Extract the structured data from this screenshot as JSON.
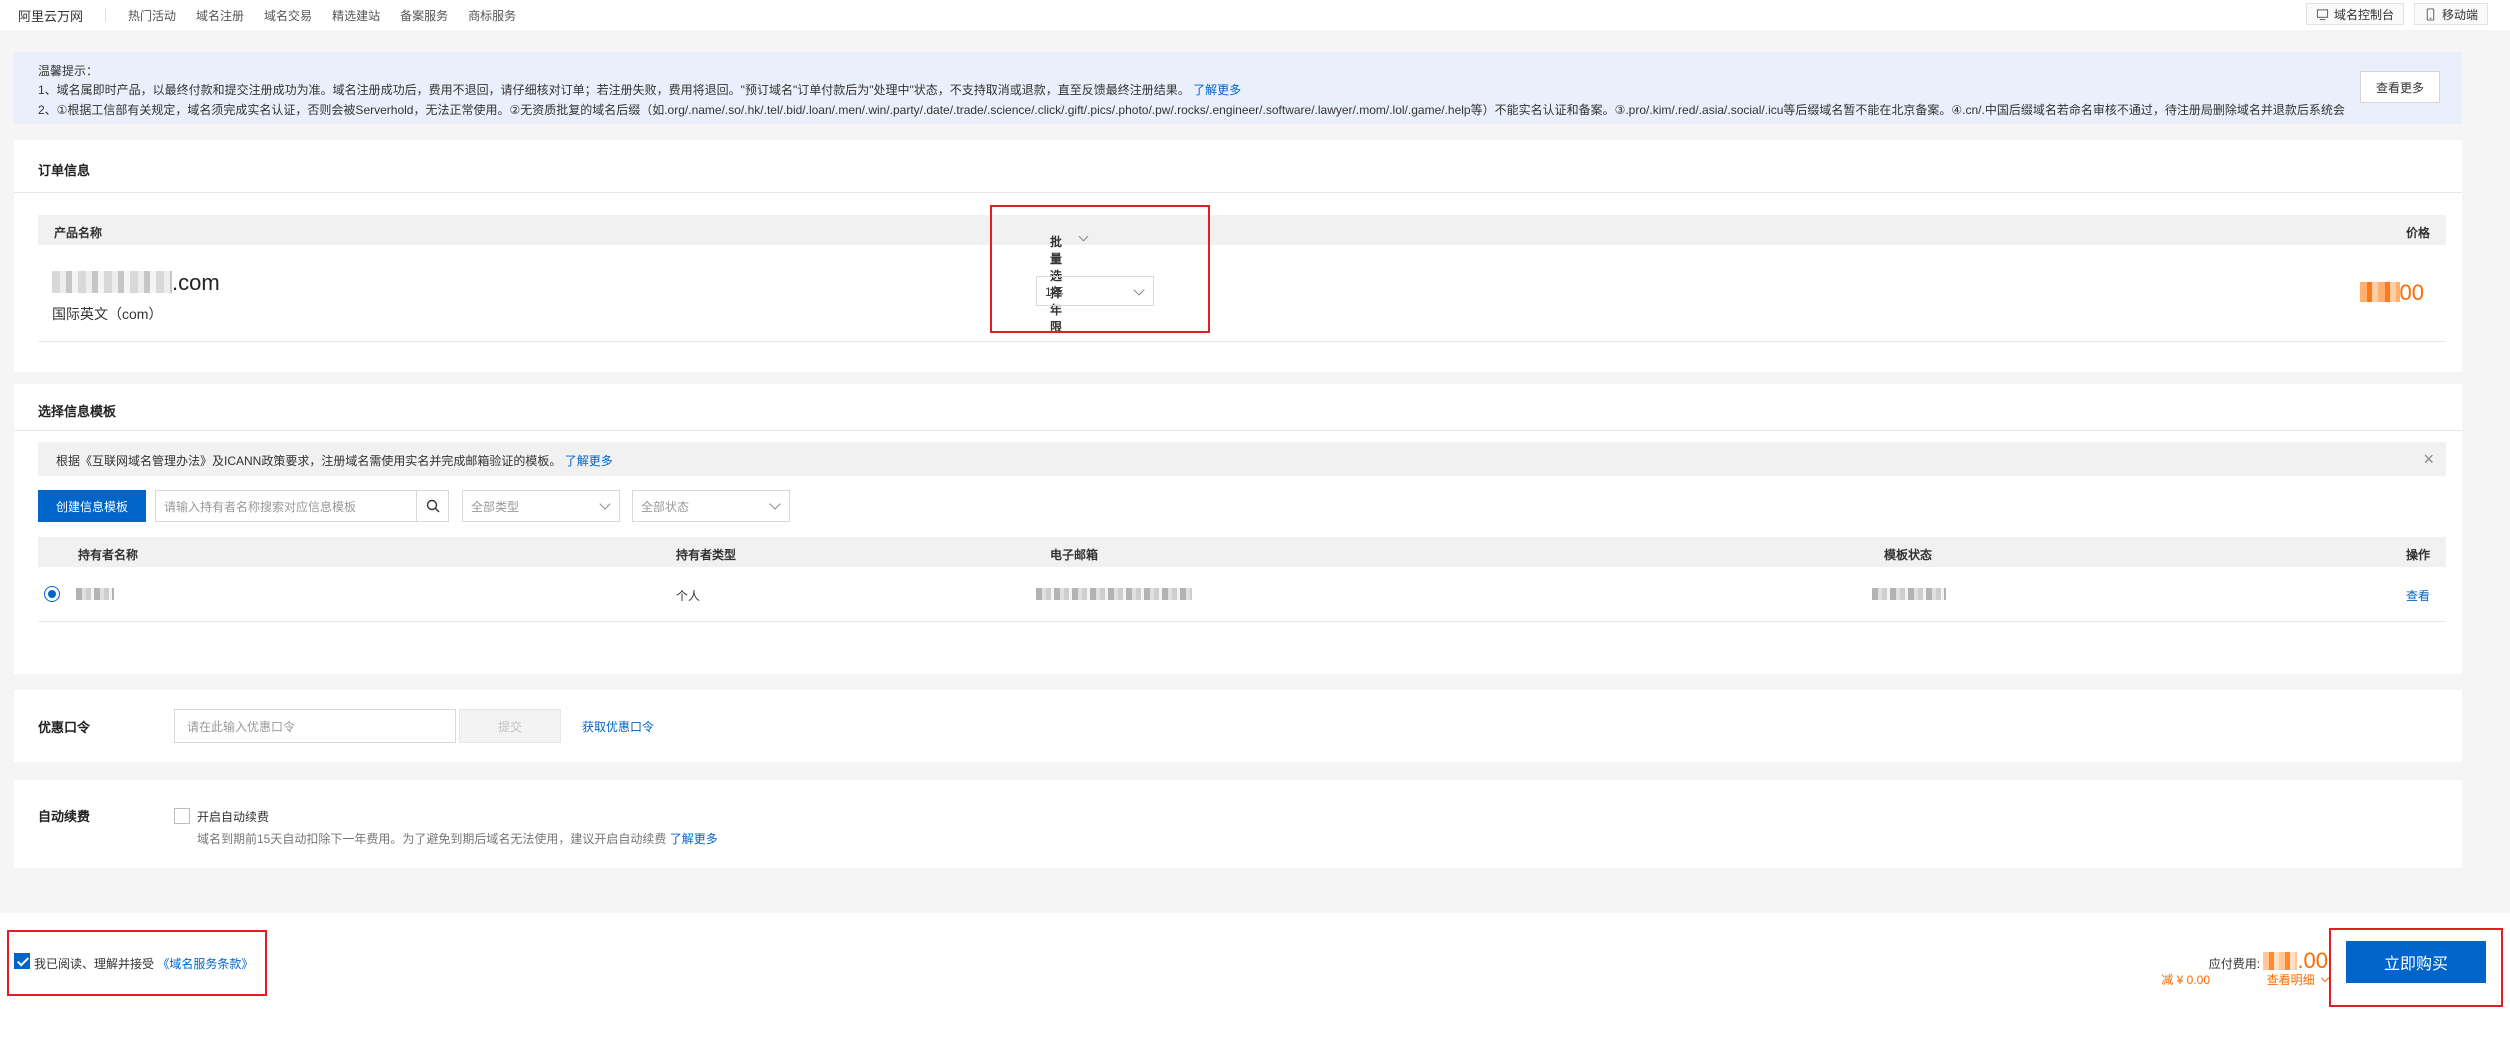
{
  "topbar": {
    "brand": "阿里云万网",
    "nav": [
      "热门活动",
      "域名注册",
      "域名交易",
      "精选建站",
      "备案服务",
      "商标服务"
    ],
    "console_label": "域名控制台",
    "mobile_label": "移动端"
  },
  "notice": {
    "title": "温馨提示：",
    "line1": "1、域名属即时产品，以最终付款和提交注册成功为准。域名注册成功后，费用不退回，请仔细核对订单；若注册失败，费用将退回。\"预订域名\"订单付款后为\"处理中\"状态，不支持取消或退款，直至反馈最终注册结果。",
    "line1_link": "了解更多",
    "line2": "2、①根据工信部有关规定，域名须完成实名认证，否则会被Serverhold，无法正常使用。②无资质批复的域名后缀（如.org/.name/.so/.hk/.tel/.bid/.loan/.men/.win/.party/.date/.trade/.science/.click/.gift/.pics/.photo/.pw/.rocks/.engineer/.software/.lawyer/.mom/.lol/.game/.help等）不能实名认证和备案。③.pro/.kim/.red/.asia/.social/.icu等后缀域名暂不能在北京备案。④.cn/.中国后缀域名若命名审核不通过，待注册局删除域名并退款后系统会",
    "more_button": "查看更多"
  },
  "order": {
    "section_title": "订单信息",
    "col_product": "产品名称",
    "col_batch_years": "批量选择年限",
    "col_price": "价格",
    "domain_suffix": ".com",
    "domain_type": "国际英文（com）",
    "year_value": "1年",
    "price_suffix": "00"
  },
  "template": {
    "section_title": "选择信息模板",
    "tip_text": "根据《互联网域名管理办法》及ICANN政策要求，注册域名需使用实名并完成邮箱验证的模板。",
    "tip_link": "了解更多",
    "create_button": "创建信息模板",
    "search_placeholder": "请输入持有者名称搜索对应信息模板",
    "filter_type": "全部类型",
    "filter_status": "全部状态",
    "columns": [
      "持有者名称",
      "持有者类型",
      "电子邮箱",
      "模板状态",
      "操作"
    ],
    "row": {
      "holder_type": "个人",
      "action": "查看"
    }
  },
  "coupon": {
    "label": "优惠口令",
    "placeholder": "请在此输入优惠口令",
    "submit": "提交",
    "get_link": "获取优惠口令"
  },
  "renew": {
    "label": "自动续费",
    "checkbox_label": "开启自动续费",
    "hint": "域名到期前15天自动扣除下一年费用。为了避免到期后域名无法使用，建议开启自动续费",
    "hint_link": "了解更多"
  },
  "footer": {
    "agree_text": "我已阅读、理解并接受",
    "terms_link": "《域名服务条款》",
    "pay_label": "应付费用:",
    "pay_suffix": ".00",
    "discount": "减 ¥ 0.00",
    "detail_link": "查看明细",
    "buy_button": "立即购买"
  },
  "colors": {
    "accent": "#0064c8",
    "price": "#ff6a00",
    "highlight_box": "#e02020"
  }
}
